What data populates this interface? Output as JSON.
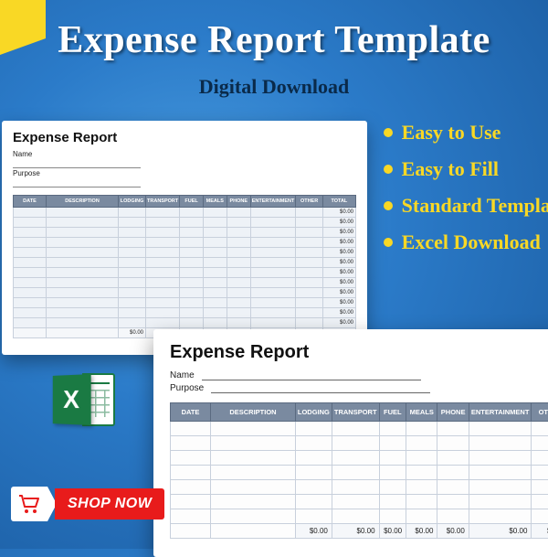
{
  "title": "Expense Report Template",
  "subtitle": "Digital Download",
  "features": [
    "Easy to Use",
    "Easy  to Fill",
    "Standard Template",
    "Excel Download"
  ],
  "report": {
    "title": "Expense Report",
    "name_label": "Name",
    "purpose_label": "Purpose",
    "columns": [
      "DATE",
      "DESCRIPTION",
      "LODGING",
      "TRANSPORT",
      "FUEL",
      "MEALS",
      "PHONE",
      "ENTERTAINMENT",
      "OTHER",
      "TOTAL"
    ],
    "zero": "$0.00",
    "grand_total": "$0.00"
  },
  "shop": {
    "label": "SHOP NOW"
  },
  "excel": {
    "letter": "X"
  }
}
